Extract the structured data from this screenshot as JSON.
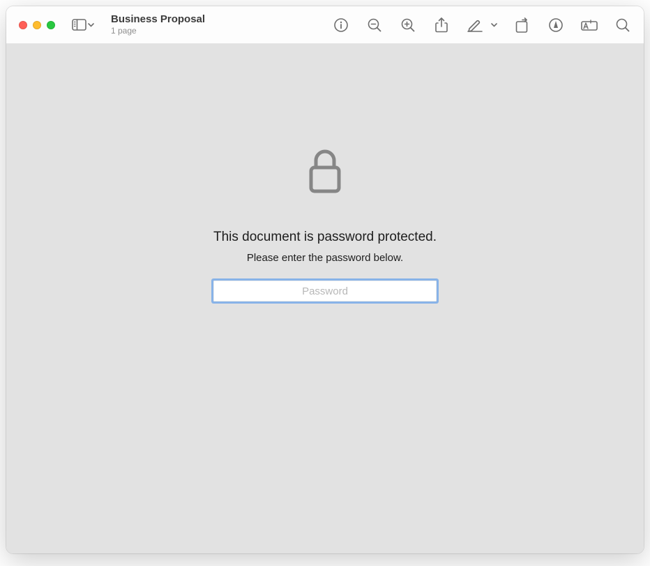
{
  "document": {
    "title": "Business Proposal",
    "subtitle": "1 page"
  },
  "passwordPrompt": {
    "heading": "This document is password protected.",
    "subtext": "Please enter the password below.",
    "placeholder": "Password"
  }
}
